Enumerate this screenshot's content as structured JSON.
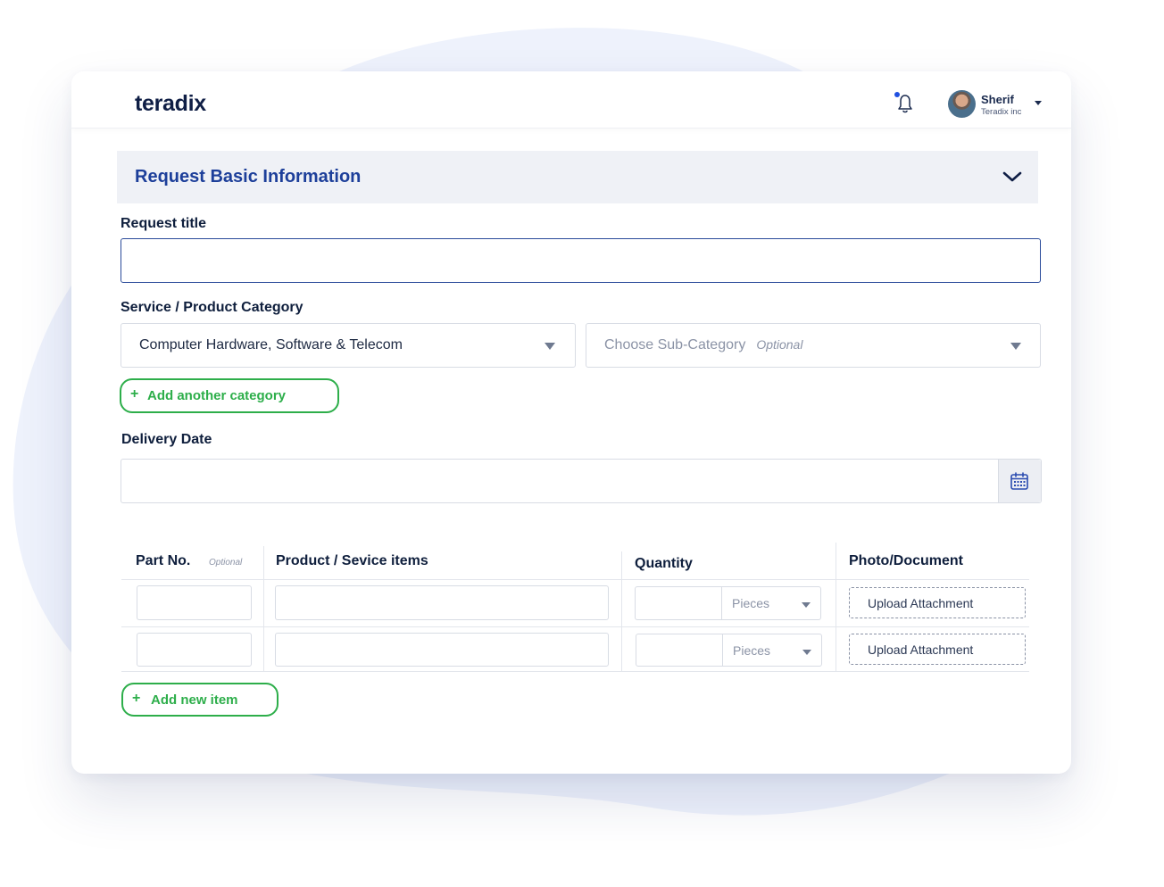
{
  "header": {
    "logo": "teradix",
    "user": {
      "name": "Sherif",
      "org": "Teradix inc"
    }
  },
  "section": {
    "title": "Request Basic Information"
  },
  "form": {
    "request_title": {
      "label": "Request title",
      "value": "",
      "placeholder": ""
    },
    "category": {
      "label": "Service / Product Category",
      "selected": "Computer Hardware, Software & Telecom",
      "sub_placeholder": "Choose Sub-Category",
      "sub_optional": "Optional"
    },
    "add_category_label": "Add another category",
    "delivery": {
      "label": "Delivery Date",
      "value": ""
    }
  },
  "items_table": {
    "headers": {
      "part_no": "Part No.",
      "part_no_optional": "Optional",
      "product": "Product / Sevice items",
      "quantity": "Quantity",
      "photo": "Photo/Document"
    },
    "rows": [
      {
        "unit": "Pieces",
        "upload_label": "Upload Attachment"
      },
      {
        "unit": "Pieces",
        "upload_label": "Upload Attachment"
      }
    ],
    "add_item_label": "Add new item"
  },
  "colors": {
    "accent_blue": "#1d3f9a",
    "accent_green": "#2dae4a",
    "brand_dark": "#0f1e45"
  }
}
